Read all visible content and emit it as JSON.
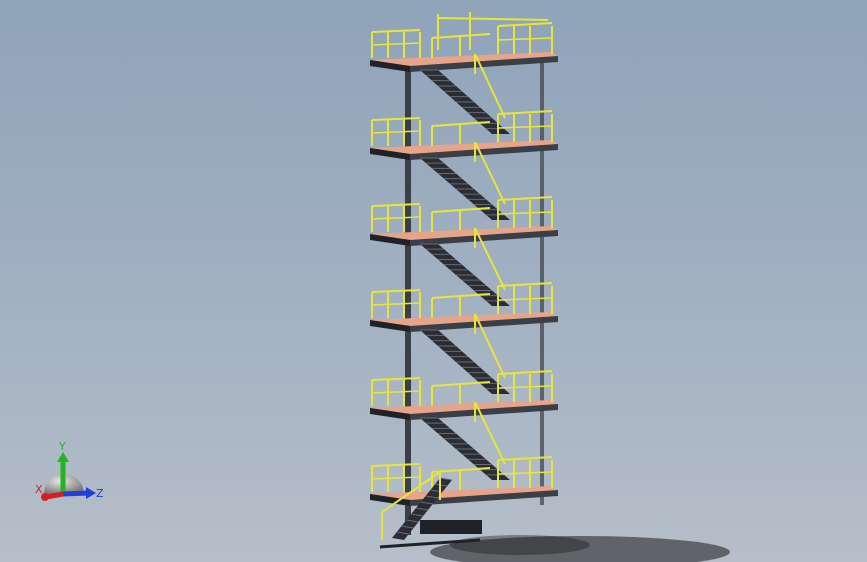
{
  "view": {
    "background_top": "#8fa3b9",
    "background_bottom": "#b6bfc9"
  },
  "model": {
    "name": "stair-tower",
    "levels": 6,
    "colors": {
      "railing": "#e6e63a",
      "railing_shadow": "#8f8f1c",
      "deck": "#e8a489",
      "frame": "#3a3e46",
      "frame_dark": "#1f2227",
      "stair": "#2a2d33",
      "shadow": "#1a1a1a"
    }
  },
  "triad": {
    "x_label": "X",
    "y_label": "Y",
    "z_label": "Z",
    "x_color": "#d81e1e",
    "y_color": "#23b323",
    "z_color": "#1e3fd8",
    "icons": [
      "view-orientation-sphere-icon"
    ]
  }
}
